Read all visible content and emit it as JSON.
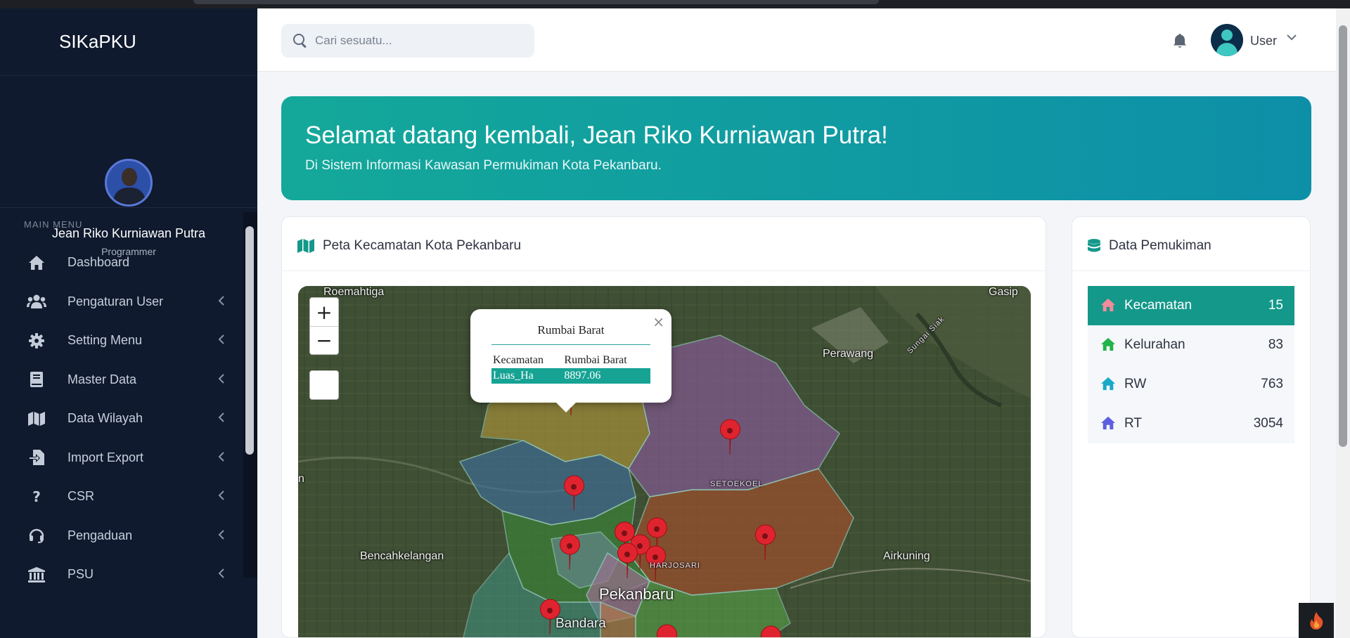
{
  "app": {
    "brand": "SIKaPKU"
  },
  "profile": {
    "name": "Jean Riko Kurniawan Putra",
    "role": "Programmer"
  },
  "sidebar": {
    "heading": "MAIN MENU",
    "items": [
      {
        "label": "Dashboard",
        "icon": "home-icon",
        "has_submenu": false
      },
      {
        "label": "Pengaturan User",
        "icon": "users-icon",
        "has_submenu": true
      },
      {
        "label": "Setting Menu",
        "icon": "gear-icon",
        "has_submenu": true
      },
      {
        "label": "Master Data",
        "icon": "book-icon",
        "has_submenu": true
      },
      {
        "label": "Data Wilayah",
        "icon": "map-icon",
        "has_submenu": true
      },
      {
        "label": "Import Export",
        "icon": "file-import-icon",
        "has_submenu": true
      },
      {
        "label": "CSR",
        "icon": "question-icon",
        "has_submenu": true
      },
      {
        "label": "Pengaduan",
        "icon": "headset-icon",
        "has_submenu": true
      },
      {
        "label": "PSU",
        "icon": "landmark-icon",
        "has_submenu": true
      }
    ]
  },
  "header": {
    "search_placeholder": "Cari sesuatu...",
    "user_label": "User"
  },
  "banner": {
    "title": "Selamat datang kembali, Jean Riko Kurniawan Putra!",
    "subtitle": "Di Sistem Informasi Kawasan Permukiman Kota Pekanbaru."
  },
  "map_card": {
    "title": "Peta Kecamatan Kota Pekanbaru",
    "zoom_in": "+",
    "zoom_out": "−",
    "labels": {
      "roemahtiga": "Roemahtiga",
      "gasip": "Gasip",
      "perawang": "Perawang",
      "sungai_siak": "Sungai Siak",
      "setoekoel": "SETOEKOEL",
      "bencahkelangan": "Bencahkelangan",
      "airkuning": "Airkuning",
      "harjosari": "HARJOSARI",
      "pekanbaru": "Pekanbaru",
      "bandara": "Bandara",
      "edge_n": "n"
    },
    "popup": {
      "title": "Rumbai Barat",
      "close": "×",
      "rows": [
        {
          "key": "Kecamatan",
          "value": "Rumbai Barat"
        },
        {
          "key": "Luas_Ha",
          "value": "8897.06"
        }
      ]
    }
  },
  "data_card": {
    "title": "Data Pemukiman",
    "rows": [
      {
        "label": "Kecamatan",
        "value": "15",
        "icon_color": "#f28b9a"
      },
      {
        "label": "Kelurahan",
        "value": "83",
        "icon_color": "#22b34a"
      },
      {
        "label": "RW",
        "value": "763",
        "icon_color": "#19a9c9"
      },
      {
        "label": "RT",
        "value": "3054",
        "icon_color": "#5b5fe0"
      }
    ]
  },
  "colors": {
    "sidebar_bg": "#0f1a2e",
    "accent": "#14988a",
    "banner_start": "#14a89a",
    "banner_end": "#0d8fa8",
    "marker": "#e0242f"
  }
}
